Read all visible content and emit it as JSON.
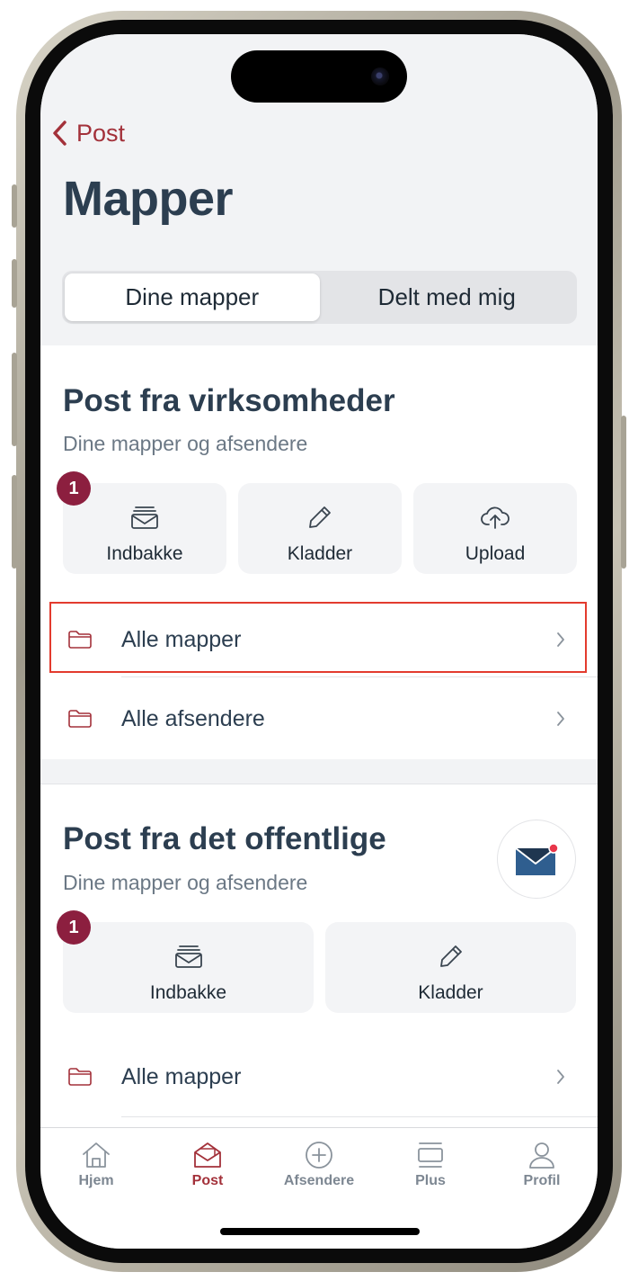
{
  "header": {
    "back_label": "Post",
    "title": "Mapper",
    "segments": [
      {
        "label": "Dine mapper",
        "active": true
      },
      {
        "label": "Delt med mig",
        "active": false
      }
    ]
  },
  "business": {
    "title": "Post fra virksomheder",
    "subtitle": "Dine mapper og afsendere",
    "inbox_badge": "1",
    "tiles": [
      {
        "label": "Indbakke",
        "icon": "inbox-icon"
      },
      {
        "label": "Kladder",
        "icon": "pencil-icon"
      },
      {
        "label": "Upload",
        "icon": "cloud-upload-icon"
      }
    ],
    "rows": [
      {
        "label": "Alle mapper",
        "icon": "folder-icon"
      },
      {
        "label": "Alle afsendere",
        "icon": "folder-icon"
      }
    ]
  },
  "public": {
    "title": "Post fra det offentlige",
    "subtitle": "Dine mapper og afsendere",
    "inbox_badge": "1",
    "tiles": [
      {
        "label": "Indbakke",
        "icon": "inbox-icon"
      },
      {
        "label": "Kladder",
        "icon": "pencil-icon"
      }
    ],
    "rows": [
      {
        "label": "Alle mapper",
        "icon": "folder-icon"
      }
    ]
  },
  "tabbar": {
    "items": [
      {
        "label": "Hjem",
        "icon": "home-icon",
        "active": false
      },
      {
        "label": "Post",
        "icon": "mail-open-icon",
        "active": true
      },
      {
        "label": "Afsendere",
        "icon": "plus-circle-icon",
        "active": false
      },
      {
        "label": "Plus",
        "icon": "stack-icon",
        "active": false
      },
      {
        "label": "Profil",
        "icon": "person-icon",
        "active": false
      }
    ]
  },
  "colors": {
    "accent": "#a3313a",
    "badge": "#8c1f3f",
    "title": "#2c3e50",
    "highlight": "#e33b2e"
  }
}
